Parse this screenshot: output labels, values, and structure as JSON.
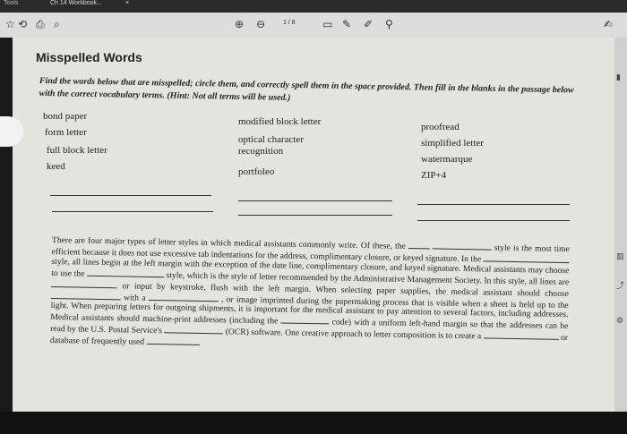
{
  "tabs": {
    "tools": "Tools",
    "document": "Ch 14 Workbook...",
    "close": "×"
  },
  "toolbar": {
    "page_current": "1",
    "page_sep": "/",
    "page_total": "8"
  },
  "section": {
    "title": "Misspelled Words",
    "instructions": "Find the words below that are misspelled; circle them, and correctly spell them in the space provided. Then fill in the blanks in the passage below with the correct vocabulary terms. (Hint: Not all terms will be used.)",
    "col1": [
      "bond paper",
      "form letter",
      "full block letter",
      "keed"
    ],
    "col2": [
      "modified block letter",
      "optical character recognition",
      "portfoleo"
    ],
    "col3": [
      "proofread",
      "simplified letter",
      "watermarque",
      "ZIP+4"
    ]
  },
  "passage": {
    "p1": "There are four major types of letter styles in which medical assistants commonly write. Of these, the",
    "p2": "style is the most time efficient because it does not use excessive tab indentations for the address, complimentary closure, or keyed signature. In the",
    "p3": "style, all lines begin at the left margin with the exception of the date line, complimentary closure, and keyed signature. Medical assistants may choose to use the",
    "p4": "style, which is the style of letter recommended by the Administrative Management Society. In this style, all lines are",
    "p5": "or input by keystroke, flush with the left margin. When selecting paper supplies, the medical assistant should choose",
    "p6": "with a",
    "p7": ", or image imprinted during the papermaking process that is visible when a sheet is held up to the light. When preparing letters for outgoing shipments, it is important for the medical assistant to pay attention to several factors, including addresses. Medical assistants should machine-print addresses (including the",
    "p8": "code) with a uniform left-hand margin so that the addresses can be read by the U.S. Postal Service's",
    "p9": "(OCR) software. One creative approach to letter composition is to create a",
    "p10": "or database of frequently used",
    "p11": "."
  }
}
